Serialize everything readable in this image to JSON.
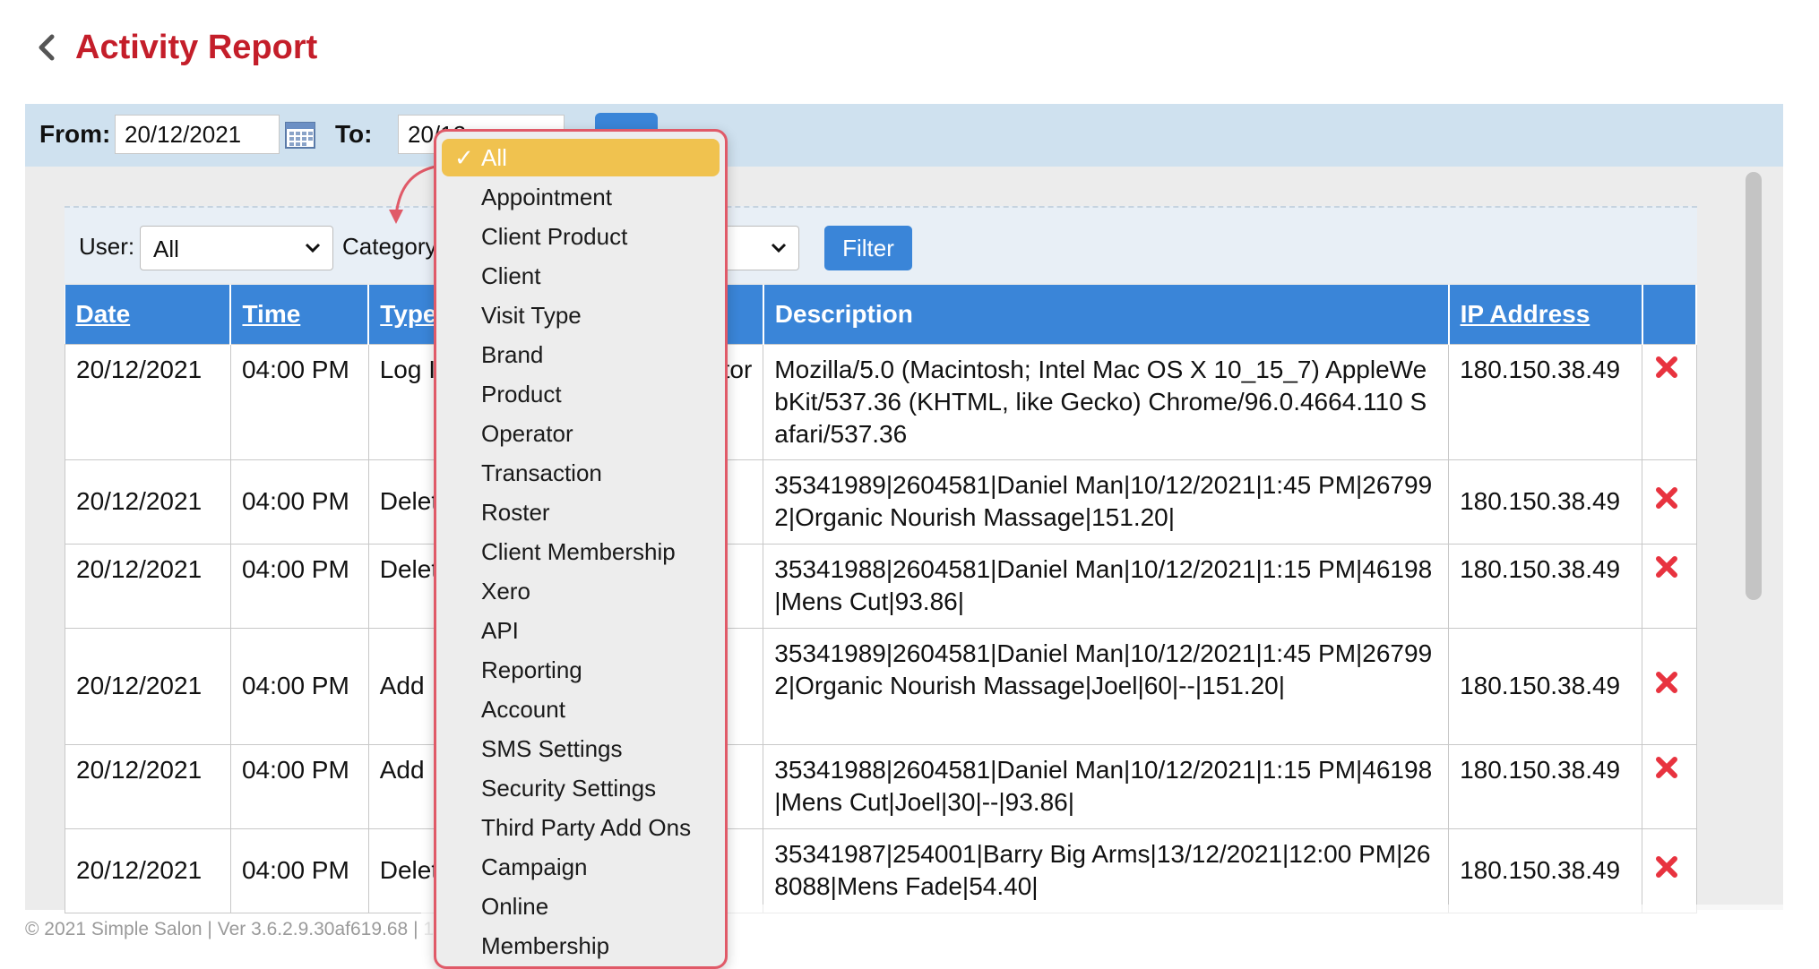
{
  "page": {
    "title": "Activity Report"
  },
  "date_filter": {
    "from_label": "From:",
    "from_value": "20/12/2021",
    "to_label": "To:",
    "to_value": "20/12"
  },
  "filters": {
    "user_label": "User:",
    "user_value": "All",
    "category_label": "Category",
    "filter_button": "Filter"
  },
  "table": {
    "headers": {
      "date": "Date",
      "time": "Time",
      "type": "Type",
      "description": "Description",
      "ip": "IP Address"
    },
    "rows": [
      {
        "date": "20/12/2021",
        "time": "04:00 PM",
        "type": "Log In",
        "user": "trator",
        "description": "Mozilla/5.0 (Macintosh; Intel Mac OS X 10_15_7) AppleWebKit/537.36 (KHTML, like Gecko) Chrome/96.0.4664.110 Safari/537.36",
        "ip": "180.150.38.49"
      },
      {
        "date": "20/12/2021",
        "time": "04:00 PM",
        "type": "Delete",
        "user": "",
        "description": "35341989|2604581|Daniel Man|10/12/2021|1:45 PM|267992|Organic Nourish Massage|151.20|",
        "ip": "180.150.38.49"
      },
      {
        "date": "20/12/2021",
        "time": "04:00 PM",
        "type": "Delete",
        "user": "",
        "description": "35341988|2604581|Daniel Man|10/12/2021|1:15 PM|46198|Mens Cut|93.86|",
        "ip": "180.150.38.49"
      },
      {
        "date": "20/12/2021",
        "time": "04:00 PM",
        "type": "Add",
        "user": "",
        "description": "35341989|2604581|Daniel Man|10/12/2021|1:45 PM|267992|Organic Nourish Massage|Joel|60|--|151.20|",
        "ip": "180.150.38.49"
      },
      {
        "date": "20/12/2021",
        "time": "04:00 PM",
        "type": "Add",
        "user": "",
        "description": "35341988|2604581|Daniel Man|10/12/2021|1:15 PM|46198|Mens Cut|Joel|30|--|93.86|",
        "ip": "180.150.38.49"
      },
      {
        "date": "20/12/2021",
        "time": "04:00 PM",
        "type": "Delete",
        "user": "",
        "description": "35341987|254001|Barry Big Arms|13/12/2021|12:00 PM|268088|Mens Fade|54.40|",
        "ip": "180.150.38.49"
      }
    ]
  },
  "category_dropdown": {
    "selected": "All",
    "options": [
      "All",
      "Appointment",
      "Client Product",
      "Client",
      "Visit Type",
      "Brand",
      "Product",
      "Operator",
      "Transaction",
      "Roster",
      "Client Membership",
      "Xero",
      "API",
      "Reporting",
      "Account",
      "SMS Settings",
      "Security Settings",
      "Third Party Add Ons",
      "Campaign",
      "Online",
      "Membership"
    ]
  },
  "footer": {
    "text": "© 2021 Simple Salon | Ver 3.6.2.9.30af619.68 | 1"
  },
  "colors": {
    "title": "#c41e2a",
    "header_blue": "#3a85d8",
    "selected_item": "#f0c24f",
    "popup_border": "#e05a68",
    "delete": "#e8333f"
  },
  "icons": [
    "chevron-left-icon",
    "calendar-icon",
    "chevron-down-icon",
    "delete-x-icon",
    "checkmark-icon",
    "arrow-annotation"
  ]
}
